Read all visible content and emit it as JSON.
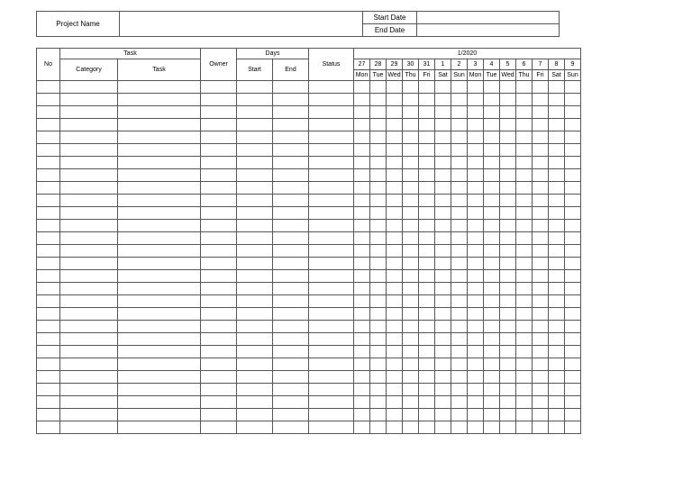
{
  "header": {
    "project_name_label": "Project Name",
    "project_name_value": "",
    "start_date_label": "Start Date",
    "start_date_value": "",
    "end_date_label": "End Date",
    "end_date_value": ""
  },
  "columns": {
    "no": "No",
    "task_group": "Task",
    "category": "Category",
    "task": "Task",
    "owner": "Owner",
    "days_group": "Days",
    "start": "Start",
    "end": "End",
    "status": "Status"
  },
  "calendar": {
    "month_label": "1/2020",
    "days": [
      {
        "num": "27",
        "dow": "Mon"
      },
      {
        "num": "28",
        "dow": "Tue"
      },
      {
        "num": "29",
        "dow": "Wed"
      },
      {
        "num": "30",
        "dow": "Thu"
      },
      {
        "num": "31",
        "dow": "Fri"
      },
      {
        "num": "1",
        "dow": "Sat"
      },
      {
        "num": "2",
        "dow": "Sun"
      },
      {
        "num": "3",
        "dow": "Mon"
      },
      {
        "num": "4",
        "dow": "Tue"
      },
      {
        "num": "5",
        "dow": "Wed"
      },
      {
        "num": "6",
        "dow": "Thu"
      },
      {
        "num": "7",
        "dow": "Fri"
      },
      {
        "num": "8",
        "dow": "Sat"
      },
      {
        "num": "9",
        "dow": "Sun"
      }
    ]
  },
  "row_count": 28
}
